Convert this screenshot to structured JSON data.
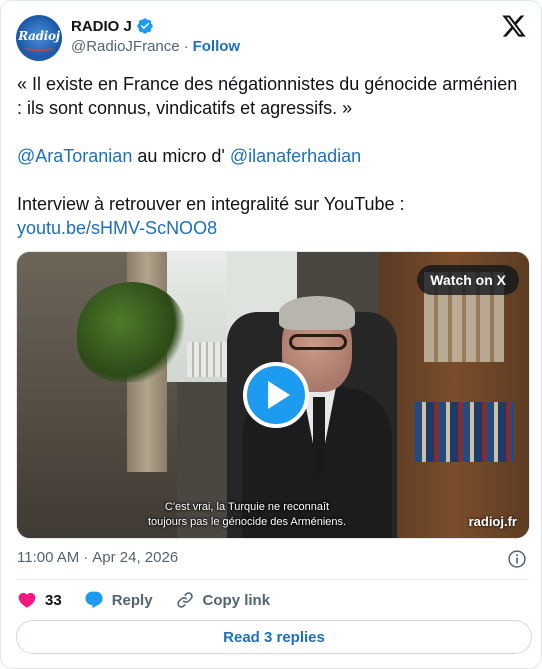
{
  "author": {
    "avatar_text": "Radioj",
    "display_name": "RADIO J",
    "handle": "@RadioJFrance",
    "separator": "·",
    "follow_label": "Follow"
  },
  "tweet": {
    "line1": "« Il existe en France des négationnistes du génocide arménien : ils sont connus, vindicatifs et agressifs. »",
    "mention1": "@AraToranian",
    "between_mentions": " au micro d' ",
    "mention2": "@ilanaferhadian",
    "line3": "Interview à retrouver en integralité sur YouTube :",
    "link": "youtu.be/sHMV-ScNOO8"
  },
  "media": {
    "watch_label": "Watch on X",
    "subtitle_line1": "C'est vrai, la Turquie ne reconnaît",
    "subtitle_line2": "toujours pas le génocide des Arméniens.",
    "watermark": "radioj.fr"
  },
  "meta": {
    "time": "11:00 AM",
    "separator": "·",
    "date": "Apr 24, 2026"
  },
  "actions": {
    "like_count": "33",
    "reply_label": "Reply",
    "copy_link_label": "Copy link"
  },
  "read_replies_label": "Read 3 replies",
  "colors": {
    "accent": "#1d6fbf",
    "play": "#1d9bf0",
    "like": "#f91880",
    "muted": "#536471"
  },
  "icons": [
    "verified-icon",
    "x-logo-icon",
    "play-icon",
    "info-icon",
    "heart-icon",
    "reply-icon",
    "link-icon"
  ]
}
